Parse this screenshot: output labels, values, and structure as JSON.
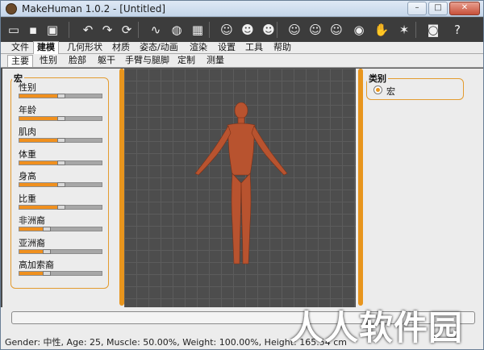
{
  "window": {
    "title": "MakeHuman 1.0.2 - [Untitled]",
    "min": "–",
    "max": "□",
    "close": "✕"
  },
  "toolbar": {
    "buttons": [
      {
        "name": "open-icon",
        "glyph": "▭"
      },
      {
        "name": "save-icon",
        "glyph": "▪"
      },
      {
        "name": "export-icon",
        "glyph": "▣"
      },
      {
        "name": "undo-icon",
        "glyph": "↶"
      },
      {
        "name": "redo-icon",
        "glyph": "↷"
      },
      {
        "name": "reset-icon",
        "glyph": "⟳"
      },
      {
        "name": "smooth-icon",
        "glyph": "∿"
      },
      {
        "name": "wireframe-icon",
        "glyph": "◍"
      },
      {
        "name": "background-checker-icon",
        "glyph": "▦"
      },
      {
        "name": "front-view-icon",
        "glyph": "☺"
      },
      {
        "name": "back-view-icon",
        "glyph": "☻"
      },
      {
        "name": "left-view-icon",
        "glyph": "☻"
      },
      {
        "name": "head-front-icon",
        "glyph": "☺"
      },
      {
        "name": "head-side-icon",
        "glyph": "☺"
      },
      {
        "name": "head-top-icon",
        "glyph": "☺"
      },
      {
        "name": "eye-view-icon",
        "glyph": "◉"
      },
      {
        "name": "hands-icon",
        "glyph": "✋"
      },
      {
        "name": "skeleton-icon",
        "glyph": "✶"
      },
      {
        "name": "camera-icon",
        "glyph": "◙"
      },
      {
        "name": "help-icon",
        "glyph": "?"
      }
    ]
  },
  "menu": {
    "items": [
      "文件",
      "建模",
      "几何形状",
      "材质",
      "姿态/动画",
      "渲染",
      "设置",
      "工具",
      "帮助"
    ],
    "active": "建模"
  },
  "subtabs": {
    "items": [
      "主要",
      "性别",
      "脸部",
      "躯干",
      "手臂与腿脚",
      "定制",
      "测量"
    ],
    "active": "主要"
  },
  "macro": {
    "title": "宏",
    "sliders": [
      {
        "label": "性别",
        "value": 0.5
      },
      {
        "label": "年龄",
        "value": 0.5
      },
      {
        "label": "肌肉",
        "value": 0.5
      },
      {
        "label": "体重",
        "value": 0.5
      },
      {
        "label": "身高",
        "value": 0.5
      },
      {
        "label": "比重",
        "value": 0.5
      },
      {
        "label": "非洲裔",
        "value": 0.33
      },
      {
        "label": "亚洲裔",
        "value": 0.33
      },
      {
        "label": "高加索裔",
        "value": 0.33
      }
    ]
  },
  "category": {
    "title": "类别",
    "option": "宏"
  },
  "status": "Gender: 中性, Age: 25, Muscle: 50.00%, Weight: 100.00%, Height: 165.54 cm",
  "watermark": "人人软件园",
  "colors": {
    "accent": "#e8951d",
    "viewport": "#4d4d4d",
    "skin": "#b8532f"
  }
}
